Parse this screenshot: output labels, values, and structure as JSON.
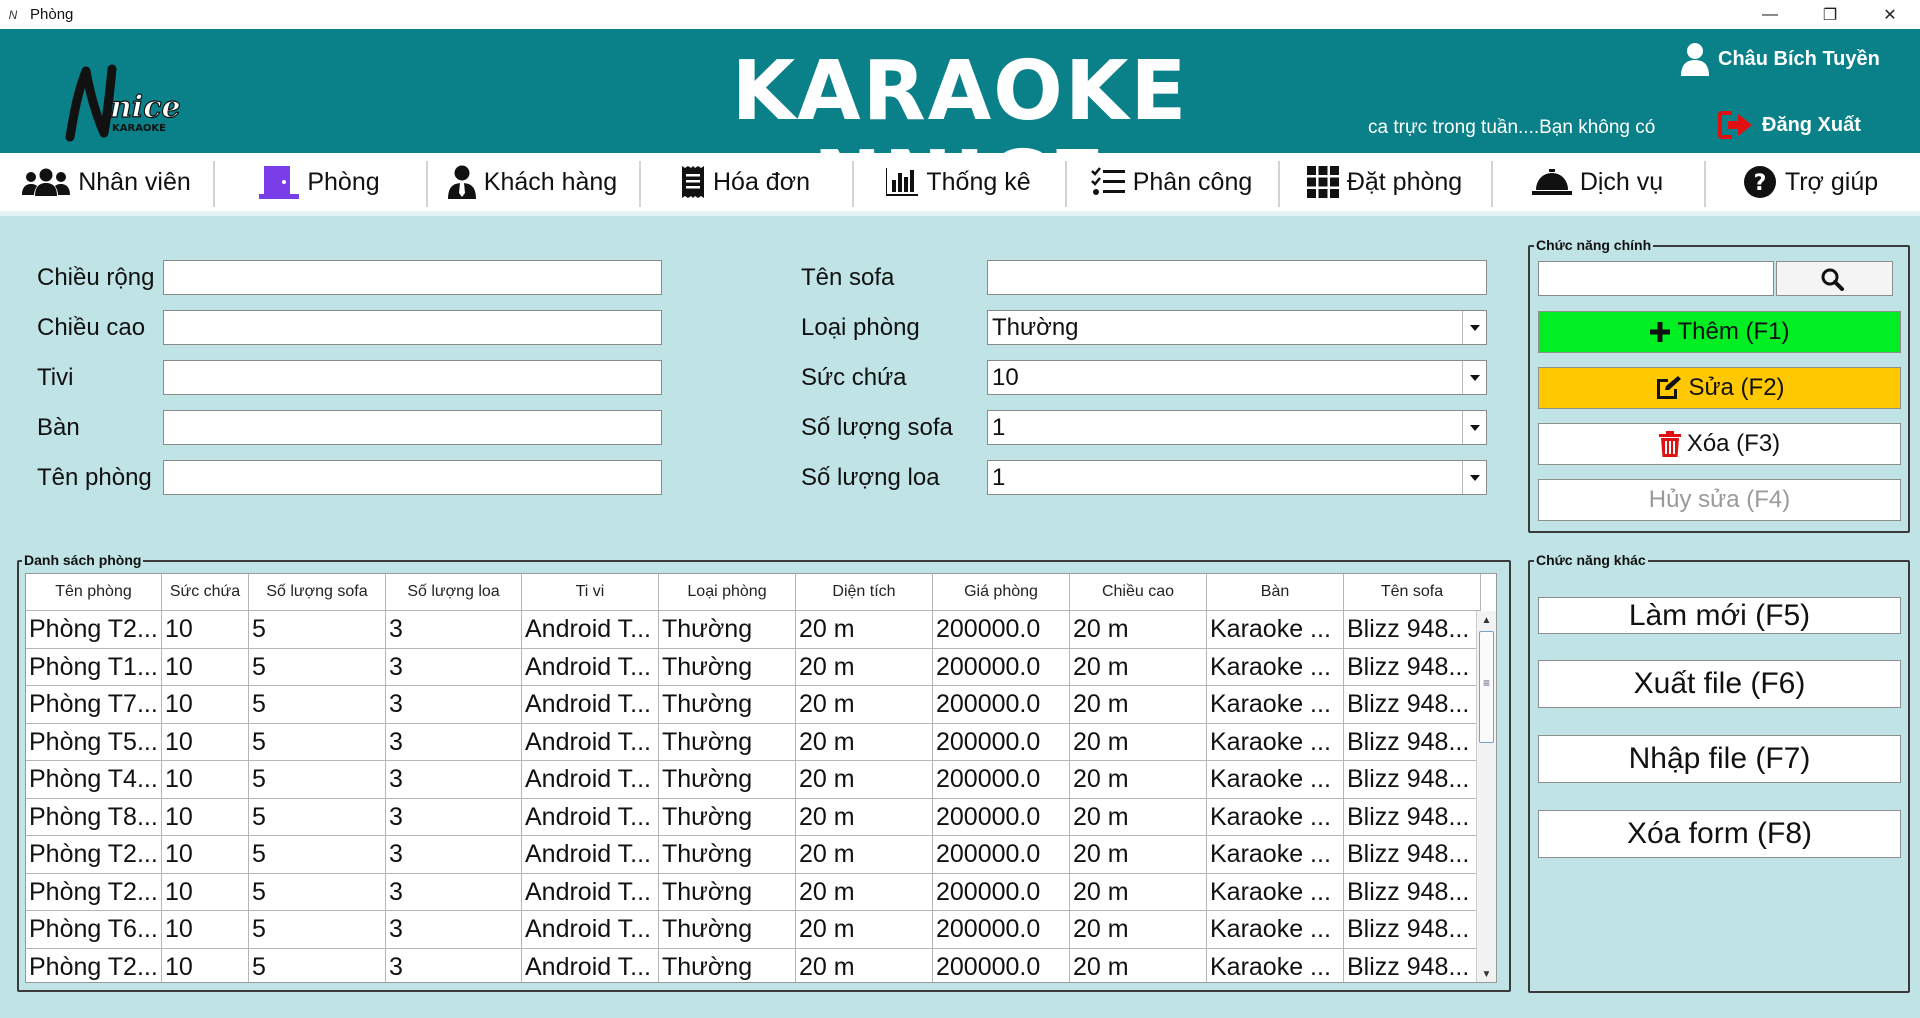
{
  "window": {
    "title": "Phòng",
    "minimize": "—",
    "maximize": "❐",
    "close": "✕"
  },
  "header": {
    "logo_text": "nice",
    "logo_sub": "KARAOKE",
    "brand": "KARAOKE NNICE",
    "user_name": "Châu Bích Tuyền",
    "shift_text": "ca trực trong tuần....Bạn không có",
    "logout_label": "Đăng Xuất",
    "color_bg": "#0a8088"
  },
  "nav": [
    {
      "label": "Nhân viên",
      "icon": "users-icon"
    },
    {
      "label": "Phòng",
      "icon": "door-icon"
    },
    {
      "label": "Khách hàng",
      "icon": "user-tie-icon"
    },
    {
      "label": "Hóa đơn",
      "icon": "receipt-icon"
    },
    {
      "label": "Thống kê",
      "icon": "bar-chart-icon"
    },
    {
      "label": "Phân công",
      "icon": "task-list-icon"
    },
    {
      "label": "Đặt phòng",
      "icon": "grid-icon"
    },
    {
      "label": "Dịch vụ",
      "icon": "service-bell-icon"
    },
    {
      "label": "Trợ giúp",
      "icon": "help-icon"
    }
  ],
  "form": {
    "width_label": "Chiều rộng",
    "height_label": "Chiều cao",
    "tv_label": "Tivi",
    "table_label": "Bàn",
    "room_name_label": "Tên phòng",
    "sofa_name_label": "Tên sofa",
    "room_type_label": "Loại phòng",
    "capacity_label": "Sức chứa",
    "sofa_count_label": "Số lượng sofa",
    "speaker_count_label": "Số lượng loa",
    "width_value": "",
    "height_value": "",
    "tv_value": "",
    "table_value": "",
    "room_name_value": "",
    "sofa_name_value": "",
    "room_type_value": "Thường",
    "capacity_value": "10",
    "sofa_count_value": "1",
    "speaker_count_value": "1"
  },
  "main_functions": {
    "title": "Chức năng chính",
    "search_value": "",
    "add_label": "Thêm (F1)",
    "edit_label": "Sửa (F2)",
    "delete_label": "Xóa (F3)",
    "cancel_label": "Hủy sửa (F4)",
    "add_color": "#00ee22",
    "edit_color": "#ffc800"
  },
  "other_functions": {
    "title": "Chức năng khác",
    "refresh_label": "Làm mới (F5)",
    "export_label": "Xuất file (F6)",
    "import_label": "Nhập file (F7)",
    "clear_label": "Xóa form (F8)"
  },
  "room_list": {
    "title": "Danh sách phòng",
    "columns": [
      "Tên phòng",
      "Sức chứa",
      "Số lượng sofa",
      "Số lượng loa",
      "Ti vi",
      "Loại phòng",
      "Diện tích",
      "Giá phòng",
      "Chiều cao",
      "Bàn",
      "Tên sofa"
    ],
    "rows": [
      [
        "Phòng T2...",
        "10",
        "5",
        "3",
        "Android T...",
        "Thường",
        "20 m",
        "200000.0",
        "20 m",
        "Karaoke ...",
        "Blizz 948..."
      ],
      [
        "Phòng T1...",
        "10",
        "5",
        "3",
        "Android T...",
        "Thường",
        "20 m",
        "200000.0",
        "20 m",
        "Karaoke ...",
        "Blizz 948..."
      ],
      [
        "Phòng T7...",
        "10",
        "5",
        "3",
        "Android T...",
        "Thường",
        "20 m",
        "200000.0",
        "20 m",
        "Karaoke ...",
        "Blizz 948..."
      ],
      [
        "Phòng T5...",
        "10",
        "5",
        "3",
        "Android T...",
        "Thường",
        "20 m",
        "200000.0",
        "20 m",
        "Karaoke ...",
        "Blizz 948..."
      ],
      [
        "Phòng T4...",
        "10",
        "5",
        "3",
        "Android T...",
        "Thường",
        "20 m",
        "200000.0",
        "20 m",
        "Karaoke ...",
        "Blizz 948..."
      ],
      [
        "Phòng T8...",
        "10",
        "5",
        "3",
        "Android T...",
        "Thường",
        "20 m",
        "200000.0",
        "20 m",
        "Karaoke ...",
        "Blizz 948..."
      ],
      [
        "Phòng T2...",
        "10",
        "5",
        "3",
        "Android T...",
        "Thường",
        "20 m",
        "200000.0",
        "20 m",
        "Karaoke ...",
        "Blizz 948..."
      ],
      [
        "Phòng T2...",
        "10",
        "5",
        "3",
        "Android T...",
        "Thường",
        "20 m",
        "200000.0",
        "20 m",
        "Karaoke ...",
        "Blizz 948..."
      ],
      [
        "Phòng T6...",
        "10",
        "5",
        "3",
        "Android T...",
        "Thường",
        "20 m",
        "200000.0",
        "20 m",
        "Karaoke ...",
        "Blizz 948..."
      ],
      [
        "Phòng T2...",
        "10",
        "5",
        "3",
        "Android T...",
        "Thường",
        "20 m",
        "200000.0",
        "20 m",
        "Karaoke ...",
        "Blizz 948..."
      ]
    ]
  }
}
